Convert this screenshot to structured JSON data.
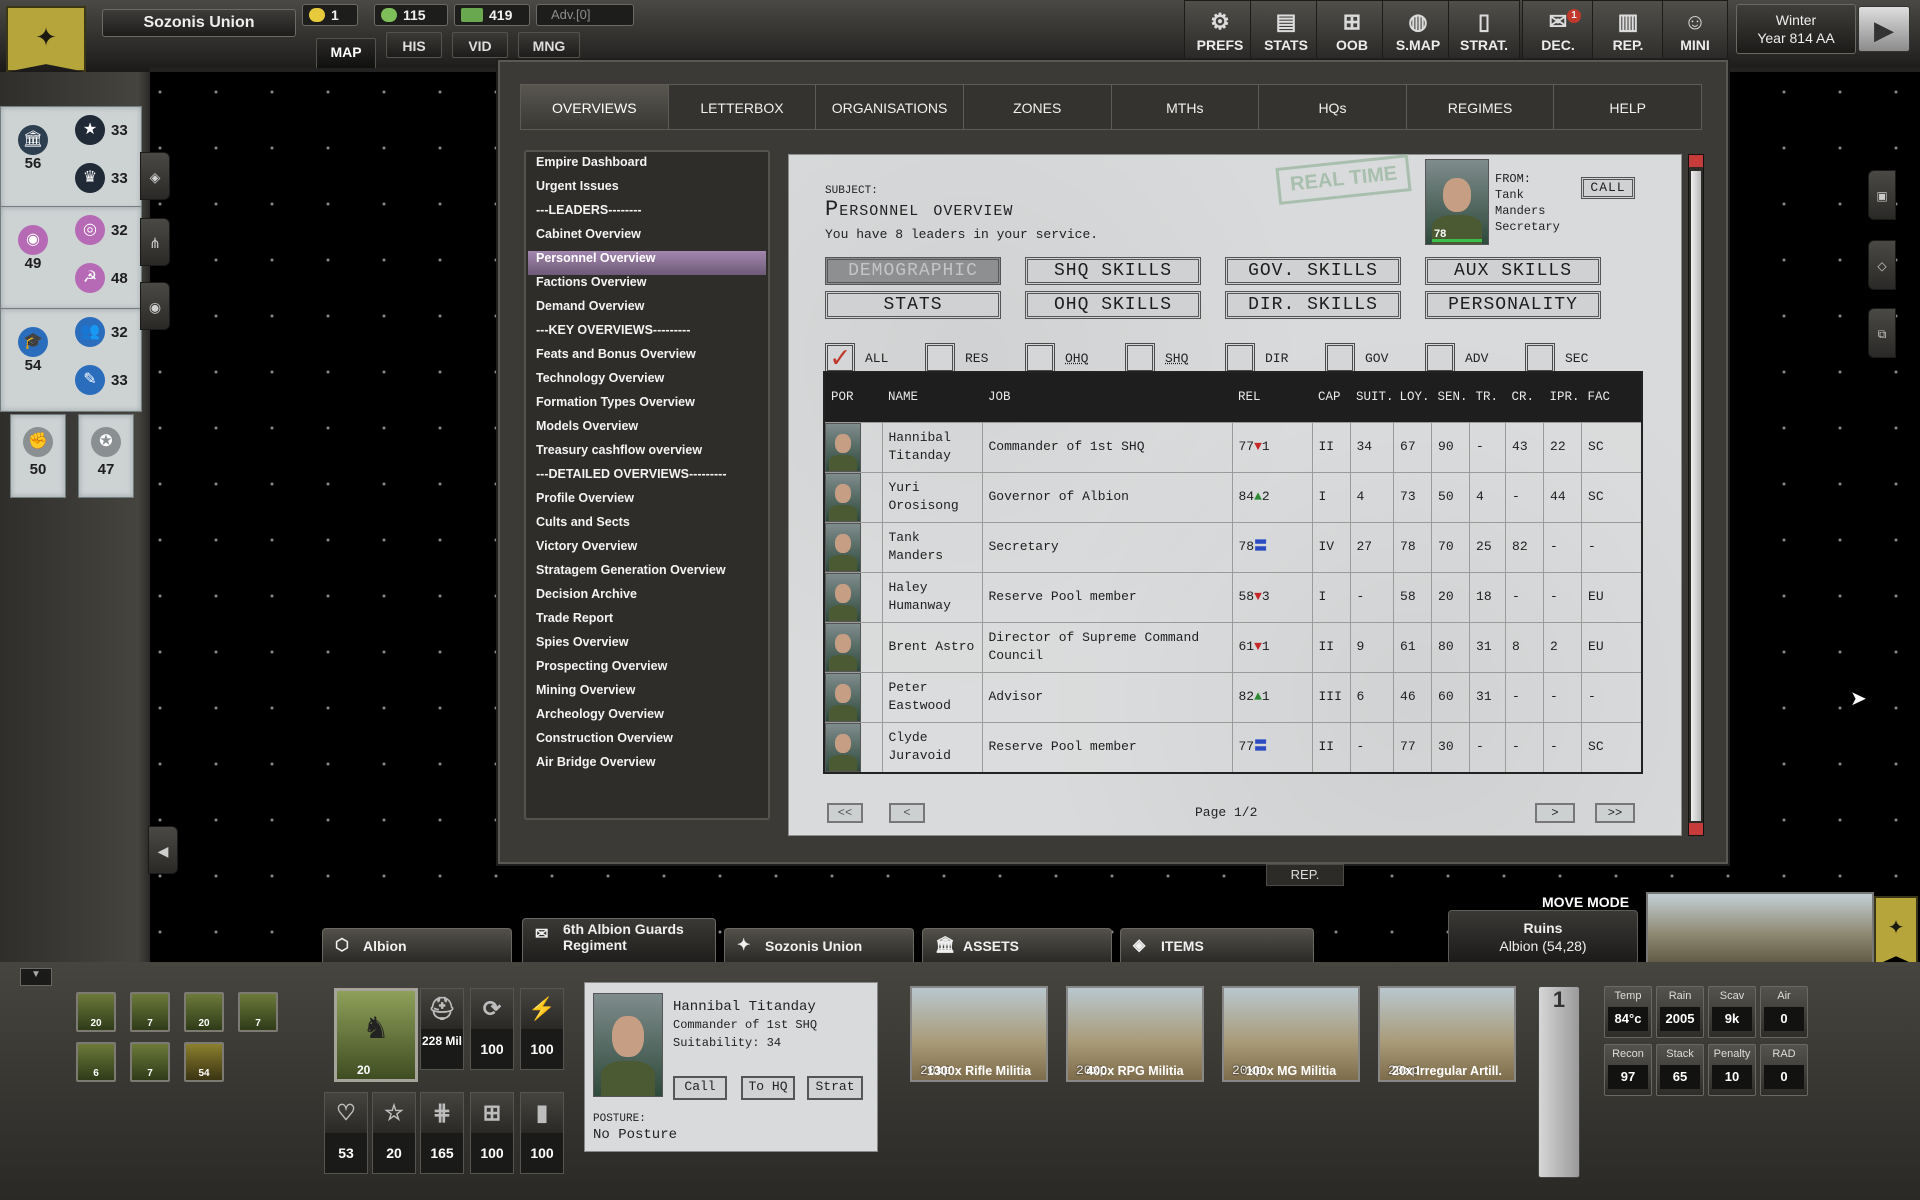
{
  "top": {
    "faction_name": "Sozonis Union",
    "resources": [
      {
        "icon": "sun-icon",
        "value": "1",
        "color": "#e7c93c"
      },
      {
        "icon": "fist-icon",
        "value": "115",
        "color": "#7fbf5a"
      },
      {
        "icon": "money-icon",
        "value": "419",
        "color": "#6aa84f"
      }
    ],
    "adv": "Adv.[0]",
    "modes": [
      "MAP",
      "HIS",
      "VID",
      "MNG"
    ],
    "tools": [
      {
        "label": "PREFS",
        "icon": "gear-icon",
        "glyph": "⚙"
      },
      {
        "label": "STATS",
        "icon": "chart-icon",
        "glyph": "▤"
      },
      {
        "label": "OOB",
        "icon": "hierarchy-icon",
        "glyph": "⊞"
      },
      {
        "label": "S.MAP",
        "icon": "globe-icon",
        "glyph": "◍"
      },
      {
        "label": "STRAT.",
        "icon": "cards-icon",
        "glyph": "▯"
      },
      {
        "label": "DEC.",
        "icon": "envelope-icon",
        "glyph": "✉",
        "badge": "1"
      },
      {
        "label": "REP.",
        "icon": "report-icon",
        "glyph": "▥"
      },
      {
        "label": "MINI",
        "icon": "person-icon",
        "glyph": "☺"
      }
    ],
    "season": "Winter",
    "year": "Year 814 AA"
  },
  "left": {
    "groups": [
      {
        "main_icon": "institution-icon",
        "main_glyph": "🏛",
        "main_value": "56",
        "subs": [
          {
            "icon": "star-icon",
            "glyph": "★",
            "value": "33"
          },
          {
            "icon": "crown-icon",
            "glyph": "♛",
            "value": "33"
          }
        ]
      },
      {
        "main_icon": "eye-icon",
        "main_glyph": "◉",
        "main_value": "49",
        "subs": [
          {
            "icon": "coins-icon",
            "glyph": "◎",
            "value": "32"
          },
          {
            "icon": "hammer-sickle-icon",
            "glyph": "☭",
            "value": "48"
          }
        ]
      },
      {
        "main_icon": "graduation-icon",
        "main_glyph": "🎓",
        "main_value": "54",
        "subs": [
          {
            "icon": "people-icon",
            "glyph": "👥",
            "value": "32"
          },
          {
            "icon": "pen-icon",
            "glyph": "✎",
            "value": "33"
          }
        ]
      }
    ],
    "extra": [
      {
        "icon": "fist-icon",
        "glyph": "✊",
        "value": "50"
      },
      {
        "icon": "star-circle-icon",
        "glyph": "✪",
        "value": "47"
      }
    ]
  },
  "window": {
    "tabs": [
      "OVERVIEWS",
      "LETTERBOX",
      "ORGANISATIONS",
      "ZONES",
      "MTHs",
      "HQs",
      "REGIMES",
      "HELP"
    ],
    "nav": [
      "Empire Dashboard",
      "Urgent Issues",
      "---LEADERS--------",
      "Cabinet Overview",
      "Personnel Overview",
      "Factions Overview",
      "Demand Overview",
      "---KEY OVERVIEWS---------",
      "Feats and Bonus Overview",
      "Technology Overview",
      "Formation Types Overview",
      "Models Overview",
      "Treasury cashflow overview",
      "---DETAILED OVERVIEWS---------",
      "Profile Overview",
      "Cults and Sects",
      "Victory Overview",
      "Stratagem Generation Overview",
      "Decision Archive",
      "Trade Report",
      "Spies Overview",
      "Prospecting Overview",
      "Mining Overview",
      "Archeology Overview",
      "Construction Overview",
      "Air Bridge Overview"
    ],
    "nav_selected": "Personnel Overview",
    "paper": {
      "subject_label": "SUBJECT:",
      "title": "Personnel overview",
      "subtitle": "You have 8 leaders in your service.",
      "stamp": "REAL TIME",
      "from_label": "FROM:",
      "from_lines": [
        "Tank",
        "Manders",
        "Secretary"
      ],
      "from_portrait_value": "78",
      "call_label": "CALL",
      "buttons": [
        "DEMOGRAPHIC",
        "SHQ SKILLS",
        "GOV. SKILLS",
        "AUX SKILLS",
        "STATS",
        "OHQ SKILLS",
        "DIR. SKILLS",
        "PERSONALITY"
      ],
      "filters": [
        "ALL",
        "RES",
        "OHQ",
        "SHQ",
        "DIR",
        "GOV",
        "ADV",
        "SEC"
      ],
      "columns": [
        "POR",
        "NAME",
        "JOB",
        "REL",
        "CAP",
        "SUIT.",
        "LOY.",
        "SEN.",
        "TR.",
        "CR.",
        "IPR.",
        "FAC"
      ],
      "rows": [
        {
          "name": "Hannibal Titanday",
          "job": "Commander of 1st SHQ",
          "rel": "77",
          "trend": "down",
          "delta": "1",
          "cap": "II",
          "suit": "34",
          "loy": "67",
          "sen": "90",
          "tr": "-",
          "cr": "43",
          "ipr": "22",
          "fac": "SC"
        },
        {
          "name": "Yuri Orosisong",
          "job": "Governor of Albion",
          "rel": "84",
          "trend": "up",
          "delta": "2",
          "cap": "I",
          "suit": "4",
          "loy": "73",
          "sen": "50",
          "tr": "4",
          "cr": "-",
          "ipr": "44",
          "fac": "SC"
        },
        {
          "name": "Tank Manders",
          "job": "Secretary",
          "rel": "78",
          "trend": "eq",
          "delta": "",
          "cap": "IV",
          "suit": "27",
          "loy": "78",
          "sen": "70",
          "tr": "25",
          "cr": "82",
          "ipr": "-",
          "fac": "-"
        },
        {
          "name": "Haley Humanway",
          "job": "Reserve Pool member",
          "rel": "58",
          "trend": "down",
          "delta": "3",
          "cap": "I",
          "suit": "-",
          "loy": "58",
          "sen": "20",
          "tr": "18",
          "cr": "-",
          "ipr": "-",
          "fac": "EU"
        },
        {
          "name": "Brent Astro",
          "job": "Director of Supreme Command Council",
          "rel": "61",
          "trend": "down",
          "delta": "1",
          "cap": "II",
          "suit": "9",
          "loy": "61",
          "sen": "80",
          "tr": "31",
          "cr": "8",
          "ipr": "2",
          "fac": "EU"
        },
        {
          "name": "Peter Eastwood",
          "job": "Advisor",
          "rel": "82",
          "trend": "up",
          "delta": "1",
          "cap": "III",
          "suit": "6",
          "loy": "46",
          "sen": "60",
          "tr": "31",
          "cr": "-",
          "ipr": "-",
          "fac": "-"
        },
        {
          "name": "Clyde Juravoid",
          "job": "Reserve Pool member",
          "rel": "77",
          "trend": "eq",
          "delta": "",
          "cap": "II",
          "suit": "-",
          "loy": "77",
          "sen": "30",
          "tr": "-",
          "cr": "-",
          "ipr": "-",
          "fac": "SC"
        }
      ],
      "pager": {
        "first": "<<",
        "prev": "<",
        "next": ">",
        "last": ">>",
        "label": "Page 1/2"
      }
    },
    "rep_label": "REP."
  },
  "bottom": {
    "move_mode": "MOVE MODE",
    "location": "Ruins",
    "location_sub": "Albion (54,28)",
    "tabs": [
      {
        "label": "Albion",
        "icon": "hex-icon",
        "glyph": "⬡"
      },
      {
        "label": "6th Albion Guards Regiment",
        "icon": "envelope-icon",
        "glyph": "✉"
      },
      {
        "label": "Sozonis Union",
        "icon": "eagle-icon",
        "glyph": "✦"
      },
      {
        "label": "ASSETS",
        "icon": "bank-icon",
        "glyph": "🏛"
      },
      {
        "label": "ITEMS",
        "icon": "box-icon",
        "glyph": "◈"
      }
    ],
    "minis": [
      "20",
      "7",
      "20",
      "7",
      "6",
      "7",
      "54"
    ],
    "unit_count": "20",
    "stats_top": [
      {
        "icon": "helmet-icon",
        "glyph": "⛑",
        "value": "228 Mil"
      },
      {
        "icon": "cycle-icon",
        "glyph": "⟳",
        "value": "100"
      },
      {
        "icon": "bolt-icon",
        "glyph": "⚡",
        "value": "100"
      }
    ],
    "stats_bottom": [
      {
        "icon": "heart-icon",
        "glyph": "♡",
        "value": "53"
      },
      {
        "icon": "star-icon",
        "glyph": "☆",
        "value": "20"
      },
      {
        "icon": "ammo-icon",
        "glyph": "⋕",
        "value": "165"
      },
      {
        "icon": "hierarchy-icon",
        "glyph": "⊞",
        "value": "100"
      },
      {
        "icon": "fuel-icon",
        "glyph": "▮",
        "value": "100"
      }
    ],
    "leader": {
      "name": "Hannibal Titanday",
      "job": "Commander of 1st SHQ",
      "suit": "Suitability: 34",
      "buttons": [
        "Call",
        "To HQ",
        "Strat"
      ],
      "posture_label": "POSTURE:",
      "posture": "No Posture"
    },
    "troops": [
      {
        "xp": "20xp",
        "name": "1300x Rifle Militia"
      },
      {
        "xp": "20xp",
        "name": "400x RPG Militia"
      },
      {
        "xp": "20xp",
        "name": "100x MG Militia"
      },
      {
        "xp": "20xp",
        "name": "20x Irregular Artill."
      }
    ],
    "page_num": "1",
    "env": [
      {
        "k": "Temp",
        "v": "84°c"
      },
      {
        "k": "Rain",
        "v": "2005"
      },
      {
        "k": "Scav",
        "v": "9k"
      },
      {
        "k": "Air",
        "v": "0"
      },
      {
        "k": "Recon",
        "v": "97"
      },
      {
        "k": "Stack",
        "v": "65"
      },
      {
        "k": "Penalty",
        "v": "10"
      },
      {
        "k": "RAD",
        "v": "0"
      }
    ]
  }
}
